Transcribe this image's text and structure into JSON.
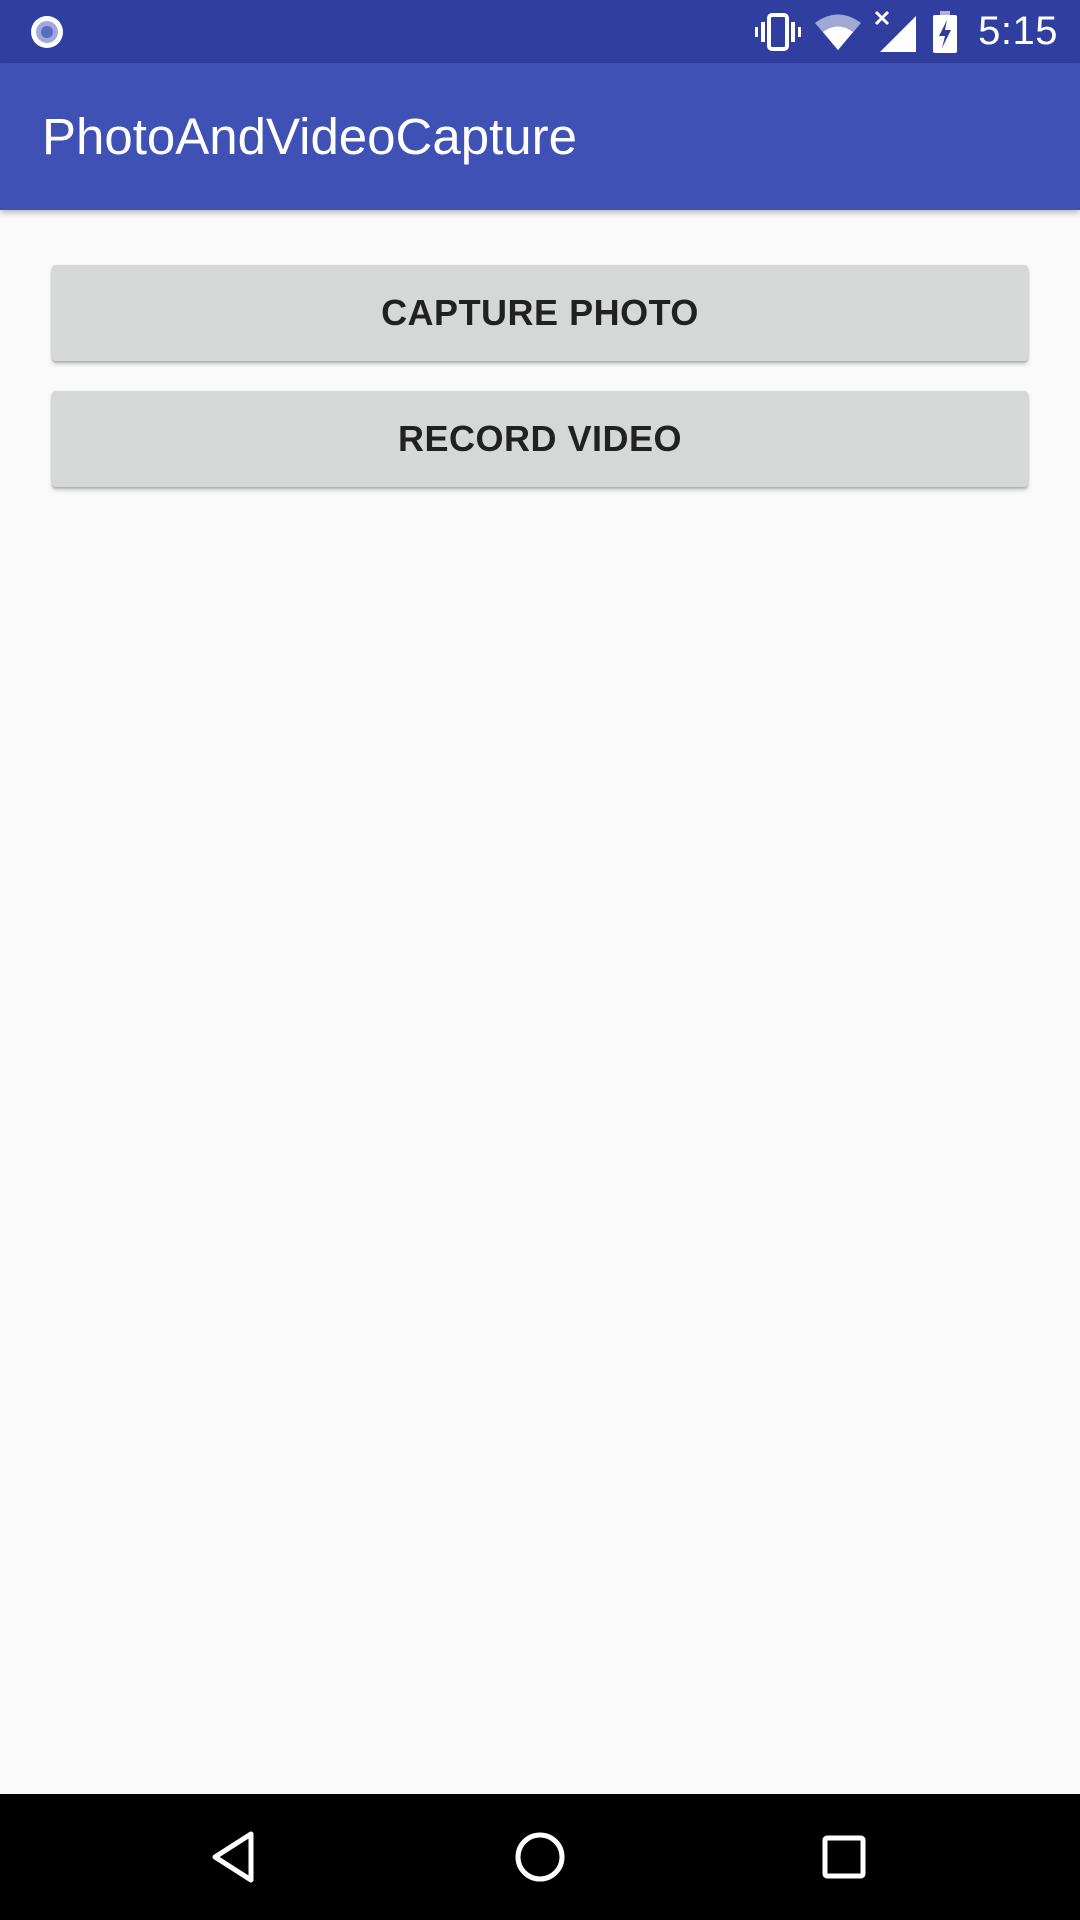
{
  "status_bar": {
    "time": "5:15",
    "icons": [
      "notification-circle-icon",
      "vibrate-icon",
      "wifi-icon",
      "cell-signal-no-data-icon",
      "battery-charging-icon"
    ],
    "color": "#303f9f"
  },
  "app_bar": {
    "title": "PhotoAndVideoCapture",
    "color": "#3f51b5"
  },
  "main": {
    "capture_photo_label": "CAPTURE PHOTO",
    "record_video_label": "RECORD VIDEO",
    "button_color": "#d6d7d7"
  },
  "nav_bar": {
    "icons": [
      "back-icon",
      "home-icon",
      "recents-icon"
    ]
  }
}
